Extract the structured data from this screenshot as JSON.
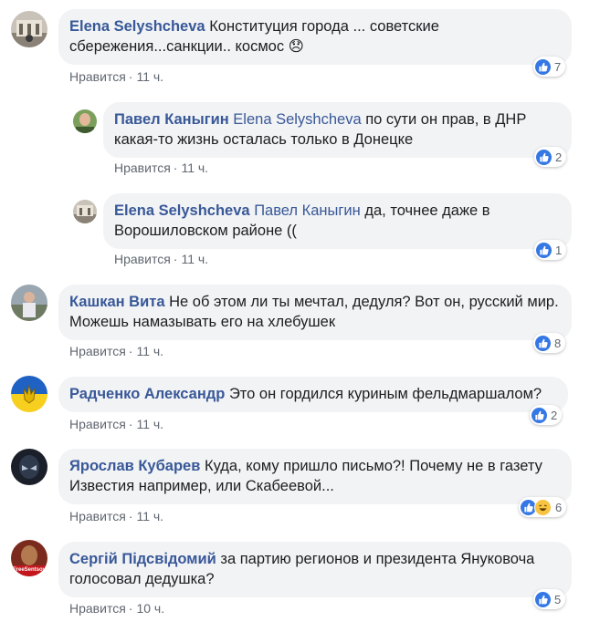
{
  "comments": [
    {
      "author": "Elena Selyshcheva",
      "mention": "",
      "text": "Конституция города ... советские сбережения...санкции.. космос 😞",
      "like_label": "Нравится",
      "time": "11 ч.",
      "reactions": 7
    },
    {
      "author": "Павел Каныгин",
      "mention": "Elena Selyshcheva",
      "text": "по сути он прав, в ДНР какая-то жизнь осталась только в Донецке",
      "like_label": "Нравится",
      "time": "11 ч.",
      "reactions": 2
    },
    {
      "author": "Elena Selyshcheva",
      "mention": "Павел Каныгин",
      "text": "да, точнее даже в Ворошиловском районе ((",
      "like_label": "Нравится",
      "time": "11 ч.",
      "reactions": 1
    },
    {
      "author": "Кашкан Вита",
      "mention": "",
      "text": "Не об этом ли ты мечтал, дедуля? Вот он, русский мир. Можешь намазывать его на хлебушек",
      "like_label": "Нравится",
      "time": "11 ч.",
      "reactions": 8
    },
    {
      "author": "Радченко Александр",
      "mention": "",
      "text": "Это он гордился куриным фельдмаршалом?",
      "like_label": "Нравится",
      "time": "11 ч.",
      "reactions": 2
    },
    {
      "author": "Ярослав Кубарев",
      "mention": "",
      "text": "Куда, кому пришло письмо?! Почему не в газету Известия например, или Скабеевой...",
      "like_label": "Нравится",
      "time": "11 ч.",
      "reactions": 6
    },
    {
      "author": "Сергій Підсвідомий",
      "mention": "",
      "text": "за партию регионов и президента Януковоча голосовал дедушка?",
      "like_label": "Нравится",
      "time": "10 ч.",
      "reactions": 5
    }
  ],
  "avatar_badge_text": "FreeSentsov",
  "colors": {
    "author": "#385898",
    "bubble": "#f2f3f5",
    "meta": "#606770",
    "like": "#3578e5"
  }
}
